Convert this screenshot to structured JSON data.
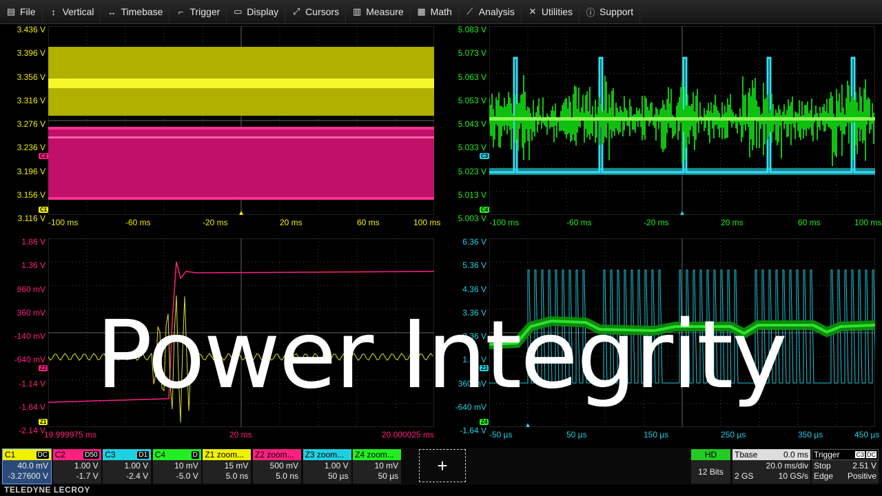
{
  "menu": [
    {
      "label": "File",
      "icon": "file-icon"
    },
    {
      "label": "Vertical",
      "icon": "vertical-arrows-icon"
    },
    {
      "label": "Timebase",
      "icon": "horizontal-arrows-icon"
    },
    {
      "label": "Trigger",
      "icon": "trigger-icon"
    },
    {
      "label": "Display",
      "icon": "display-icon"
    },
    {
      "label": "Cursors",
      "icon": "cursors-icon"
    },
    {
      "label": "Measure",
      "icon": "measure-icon"
    },
    {
      "label": "Math",
      "icon": "math-icon"
    },
    {
      "label": "Analysis",
      "icon": "analysis-icon"
    },
    {
      "label": "Utilities",
      "icon": "utilities-icon"
    },
    {
      "label": "Support",
      "icon": "support-icon"
    }
  ],
  "grids": {
    "top_left": {
      "y_labels": [
        "3.436 V",
        "3.396 V",
        "3.356 V",
        "3.316 V",
        "3.276 V",
        "3.236 V",
        "3.196 V",
        "3.156 V",
        "3.116 V"
      ],
      "x_labels": [
        "-100 ms",
        "-60 ms",
        "-20 ms",
        "20 ms",
        "60 ms",
        "100 ms"
      ],
      "label_color": "#f0f000",
      "markers": [
        {
          "text": "C2",
          "color": "#ff2080"
        },
        {
          "text": "C1",
          "color": "#f0f000"
        }
      ]
    },
    "top_right": {
      "y_labels": [
        "5.083 V",
        "5.073 V",
        "5.063 V",
        "5.053 V",
        "5.043 V",
        "5.033 V",
        "5.023 V",
        "5.013 V",
        "5.003 V"
      ],
      "x_labels": [
        "-100 ms",
        "-60 ms",
        "-20 ms",
        "20 ms",
        "60 ms",
        "100 ms"
      ],
      "label_color": "#22ee22",
      "markers": [
        {
          "text": "C3",
          "color": "#20d0e0"
        },
        {
          "text": "C4",
          "color": "#22ee22"
        }
      ]
    },
    "bottom_left": {
      "y_labels": [
        "1.86 V",
        "1.36 V",
        "860 mV",
        "360 mV",
        "-140 mV",
        "-640 mV",
        "-1.14 V",
        "-1.64 V",
        "-2.14 V"
      ],
      "x_labels": [
        "19.999975 ms",
        "20 ms",
        "20.000025 ms"
      ],
      "label_color": "#ff2080",
      "markers": [
        {
          "text": "Z2",
          "color": "#ff2080"
        },
        {
          "text": "Z1",
          "color": "#f0f000"
        }
      ]
    },
    "bottom_right": {
      "y_labels": [
        "6.36 V",
        "5.36 V",
        "4.36 V",
        "3.36 V",
        "2.36 V",
        "1.36 V",
        "360 mV",
        "-640 mV",
        "-1.64 V"
      ],
      "x_labels": [
        "-50 µs",
        "50 µs",
        "150 µs",
        "250 µs",
        "350 µs",
        "450 µs"
      ],
      "label_color": "#20d0e0",
      "markers": [
        {
          "text": "Z3",
          "color": "#20d0e0"
        },
        {
          "text": "Z4",
          "color": "#22ee22"
        }
      ]
    }
  },
  "overlay_title": "Power Integrity",
  "channels": [
    {
      "name": "C1",
      "tag": "DC",
      "v1": "40.0 mV",
      "v2": "-3.27600 V",
      "color": "#f0f000",
      "selected": true
    },
    {
      "name": "C2",
      "tag": "D50",
      "v1": "1.00 V",
      "v2": "-1.7 V",
      "color": "#ff2080"
    },
    {
      "name": "C3",
      "tag": "D1",
      "v1": "1.00 V",
      "v2": "-2.4 V",
      "color": "#20d0e0"
    },
    {
      "name": "C4",
      "tag": "D",
      "v1": "10 mV",
      "v2": "-5.0 V",
      "color": "#22ee22"
    },
    {
      "name": "Z1 zoom...",
      "tag": "",
      "v1": "15 mV",
      "v2": "5.0 ns",
      "color": "#f0f000"
    },
    {
      "name": "Z2 zoom...",
      "tag": "",
      "v1": "500 mV",
      "v2": "5.0 ns",
      "color": "#ff2080"
    },
    {
      "name": "Z3 zoom...",
      "tag": "",
      "v1": "1.00 V",
      "v2": "50 µs",
      "color": "#20d0e0"
    },
    {
      "name": "Z4 zoom...",
      "tag": "",
      "v1": "10 mV",
      "v2": "50 µs",
      "color": "#22ee22"
    }
  ],
  "add_button": "+",
  "hd": {
    "label": "HD",
    "value": "12 Bits"
  },
  "tbase": {
    "label": "Tbase",
    "delay": "0.0 ms",
    "rate": "20.0 ms/div",
    "mem": "2 GS",
    "srate": "10 GS/s"
  },
  "trigger": {
    "label": "Trigger",
    "tag1": "C3",
    "tag2": "DC",
    "level": "2.51 V",
    "mode": "Stop",
    "type": "Edge",
    "slope": "Positive"
  },
  "brand": "TELEDYNE LECROY"
}
